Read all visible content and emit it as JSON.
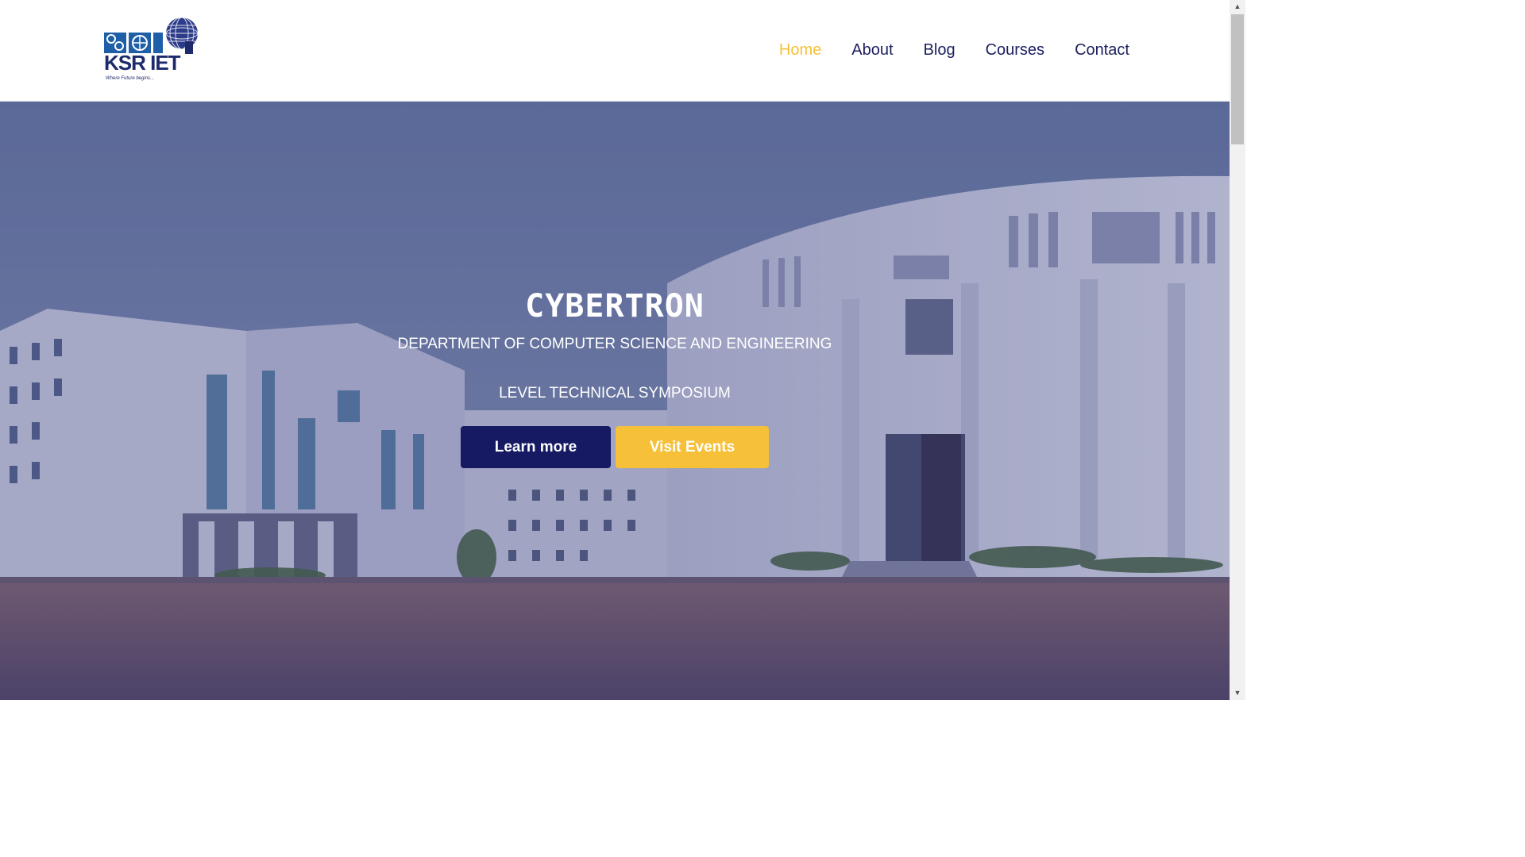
{
  "header": {
    "logo_text": "KSR IET",
    "logo_tagline": "Where Future begins...",
    "nav": [
      {
        "label": "Home",
        "active": true
      },
      {
        "label": "About",
        "active": false
      },
      {
        "label": "Blog",
        "active": false
      },
      {
        "label": "Courses",
        "active": false
      },
      {
        "label": "Contact",
        "active": false
      }
    ]
  },
  "hero": {
    "title": "CYBERTRON",
    "department": "DEPARTMENT OF COMPUTER SCIENCE AND ENGINEERING",
    "subtitle": "LEVEL TECHNICAL SYMPOSIUM",
    "learn_more_label": "Learn more",
    "visit_events_label": "Visit Events"
  },
  "colors": {
    "accent_yellow": "#f6c139",
    "navy": "#161a63",
    "nav_text": "#1b1f5e"
  },
  "icons": {
    "scroll_up": "▲",
    "scroll_down": "▼"
  }
}
